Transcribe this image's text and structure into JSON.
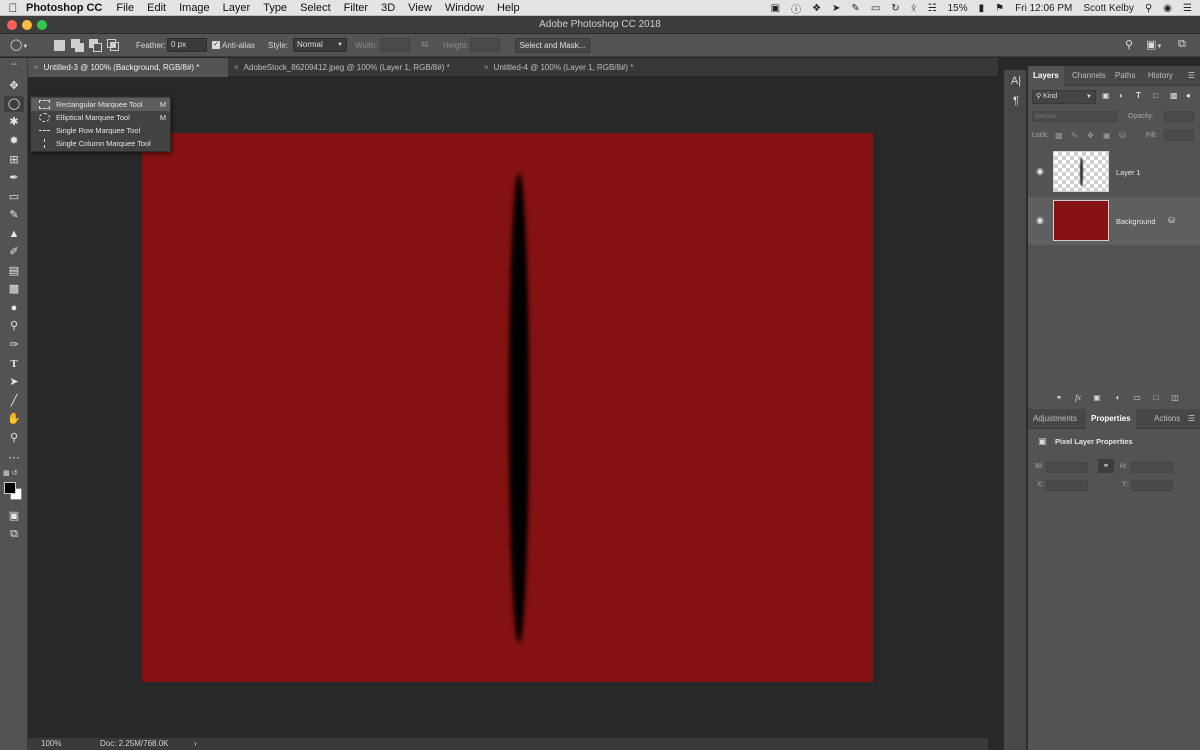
{
  "menubar": {
    "app_name": "Photoshop CC",
    "items": [
      "File",
      "Edit",
      "Image",
      "Layer",
      "Type",
      "Select",
      "Filter",
      "3D",
      "View",
      "Window",
      "Help"
    ],
    "battery": "15%",
    "clock": "Fri 12:06 PM",
    "user": "Scott Kelby"
  },
  "window": {
    "title": "Adobe Photoshop CC 2018"
  },
  "options_bar": {
    "feather_label": "Feather:",
    "feather_value": "0 px",
    "antialias_label": "Anti-alias",
    "style_label": "Style:",
    "style_value": "Normal",
    "width_label": "Width:",
    "height_label": "Height:",
    "select_mask_label": "Select and Mask..."
  },
  "tabs": [
    {
      "label": "Untitled-3 @ 100% (Background, RGB/8#) *",
      "active": true
    },
    {
      "label": "AdobeStock_86209412.jpeg @ 100% (Layer 1, RGB/8#) *",
      "active": false
    },
    {
      "label": "Untitled-4 @ 100% (Layer 1, RGB/8#) *",
      "active": false
    }
  ],
  "flyout": {
    "items": [
      {
        "label": "Rectangular Marquee Tool",
        "shortcut": "M",
        "icon": "rectangular-marquee-icon"
      },
      {
        "label": "Elliptical Marquee Tool",
        "shortcut": "M",
        "icon": "elliptical-marquee-icon"
      },
      {
        "label": "Single Row Marquee Tool",
        "shortcut": "",
        "icon": "single-row-marquee-icon"
      },
      {
        "label": "Single Column Marquee Tool",
        "shortcut": "",
        "icon": "single-column-marquee-icon"
      }
    ]
  },
  "status_bar": {
    "zoom": "100%",
    "doc_size": "Doc: 2.25M/768.0K"
  },
  "layers_panel": {
    "tabs": [
      "Layers",
      "Channels",
      "Paths",
      "History"
    ],
    "kind_label": "Kind",
    "blend_mode": "Normal",
    "opacity_label": "Opacity:",
    "lock_label": "Lock:",
    "fill_label": "Fill:",
    "layers": [
      {
        "name": "Layer 1",
        "selected": false
      },
      {
        "name": "Background",
        "selected": true
      }
    ]
  },
  "properties_panel": {
    "tabs": [
      "Adjustments",
      "Properties",
      "Actions"
    ],
    "title": "Pixel Layer Properties",
    "w_label": "W:",
    "h_label": "H:",
    "x_label": "X:",
    "y_label": "Y:"
  },
  "colors": {
    "canvas_red": "#851212",
    "ui_dark": "#282828",
    "panel_gray": "#535353"
  }
}
